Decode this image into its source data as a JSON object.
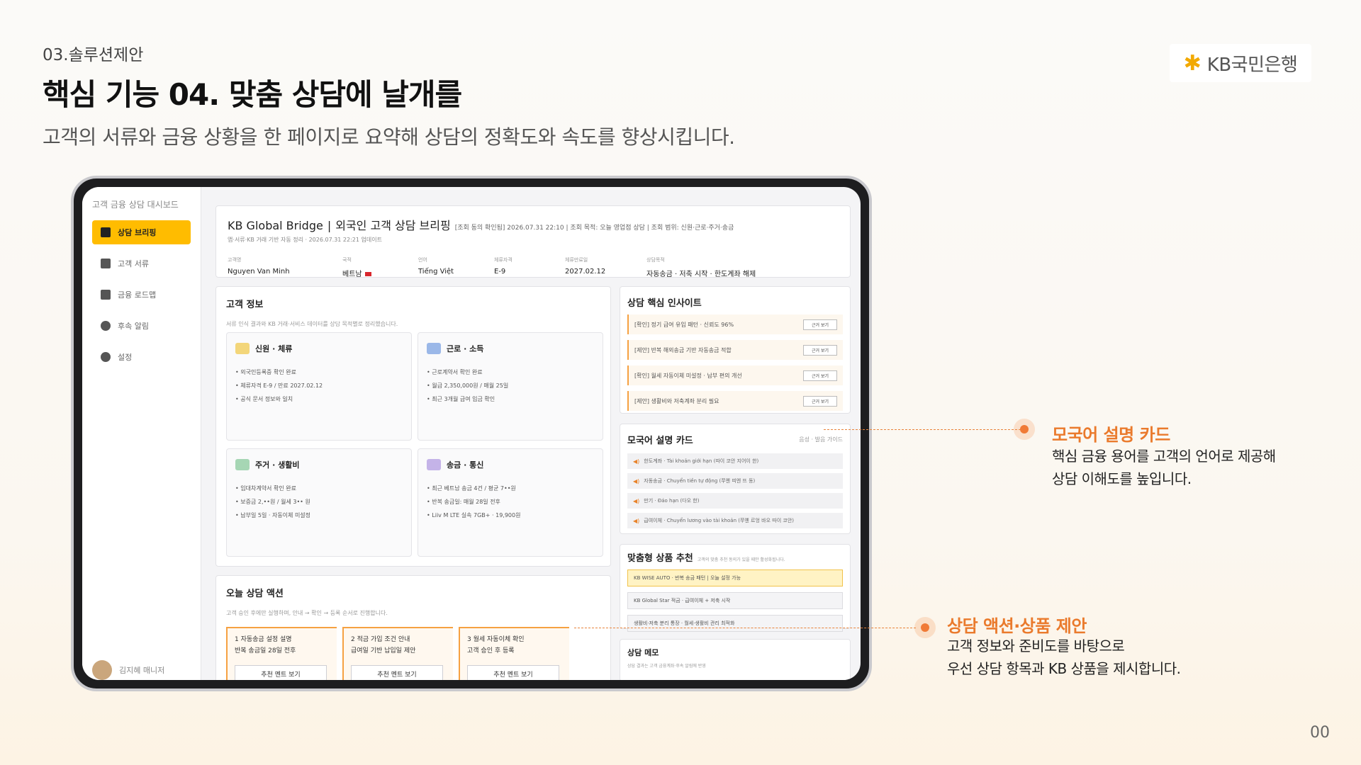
{
  "slide": {
    "section": "03.솔루션제안",
    "title": "핵심 기능 04. 맞춤 상담에 날개를",
    "subtitle": "고객의 서류와 금융 상황을 한 페이지로 요약해 상담의 정확도와 속도를 향상시킵니다.",
    "logo_text": "KB국민은행",
    "page_number": "00"
  },
  "sidebar": {
    "title": "고객 금융 상담 대시보드",
    "items": [
      {
        "label": "상담 브리핑",
        "icon": "briefing-icon",
        "active": true
      },
      {
        "label": "고객 서류",
        "icon": "document-scan-icon",
        "active": false
      },
      {
        "label": "금융 로드맵",
        "icon": "map-icon",
        "active": false
      },
      {
        "label": "후속 알림",
        "icon": "bell-icon",
        "active": false
      },
      {
        "label": "설정",
        "icon": "gear-icon",
        "active": false
      }
    ],
    "user": "김지혜 매니저"
  },
  "header": {
    "brand": "KB Global Bridge",
    "separator": "|",
    "title": "외국인 고객 상담 브리핑",
    "meta": "[조회 동의 확인됨] 2026.07.31 22:10 | 조회 목적: 오늘 영업점 상담 | 조회 범위: 신원·근로·주거·송금",
    "sub": "앱·서류·KB 거래 기반 자동 정리 · 2026.07.31 22:21 업데이트",
    "fields": [
      {
        "label": "고객명",
        "value": "Nguyen Van Minh"
      },
      {
        "label": "국적",
        "value": "베트남"
      },
      {
        "label": "언어",
        "value": "Tiếng Việt"
      },
      {
        "label": "체류자격",
        "value": "E-9"
      },
      {
        "label": "체류만료일",
        "value": "2027.02.12"
      },
      {
        "label": "상담목적",
        "value": "자동송금 · 저축 시작 · 한도계좌 해제"
      }
    ]
  },
  "customer_info": {
    "title": "고객 정보",
    "desc": "서류 인식 결과와 KB 거래·서비스 데이터를 상담 목적별로 정리했습니다.",
    "cards": [
      {
        "title": "신원 · 체류",
        "icon": "person-list-icon",
        "items": [
          "• 외국인등록증 확인 완료",
          "• 체류자격 E-9 / 만료 2027.02.12",
          "• 공식 문서 정보와 일치"
        ]
      },
      {
        "title": "근로 · 소득",
        "icon": "document-icon",
        "items": [
          "• 근로계약서 확인 완료",
          "• 월급 2,350,000원 / 매월 25일",
          "• 최근 3개월 급여 입금 확인"
        ]
      },
      {
        "title": "주거 · 생활비",
        "icon": "home-icon",
        "items": [
          "• 임대차계약서 확인 완료",
          "• 보증금 2,••원 / 월세 3•• 원",
          "• 납부일 5일 · 자동이체 미설정"
        ]
      },
      {
        "title": "송금 · 통신",
        "icon": "transfer-icon",
        "items": [
          "• 최근 베트남 송금 4건 / 평균 7••원",
          "• 반복 송금일: 매월 28일 전후",
          "• Liiv M LTE 실속 7GB+ · 19,900원"
        ]
      }
    ]
  },
  "today_actions": {
    "title": "오늘 상담 액션",
    "desc": "고객 승인 후에만 실행하며, 안내 → 확인 → 등록 순서로 진행합니다.",
    "steps": [
      {
        "title": "1 자동송금 설정 설명",
        "detail": "반복 송금일 28일 전후",
        "button": "추천 멘트 보기"
      },
      {
        "title": "2 적금 가입 조건 안내",
        "detail": "급여일 기반 납입일 제안",
        "button": "추천 멘트 보기"
      },
      {
        "title": "3 월세 자동이체 확인",
        "detail": "고객 승인 후 등록",
        "button": "추천 멘트 보기"
      }
    ]
  },
  "insights": {
    "title": "상담 핵심 인사이트",
    "rows": [
      {
        "text": "[확인] 정기 급여 유입 패턴 · 신뢰도 96%",
        "button": "근거 보기"
      },
      {
        "text": "[제안] 반복 해외송금 기반 자동송금 적합",
        "button": "근거 보기"
      },
      {
        "text": "[확인] 월세 자동이체 미설정 · 납부 편의 개선",
        "button": "근거 보기"
      },
      {
        "text": "[제안] 생활비와 저축계좌 분리 필요",
        "button": "근거 보기"
      }
    ]
  },
  "native_language": {
    "title": "모국어 설명 카드",
    "hint": "음성 · 발음 가이드",
    "rows": [
      "한도계좌 · Tài khoản giới hạn (따이 코안 지어이 한)",
      "자동송금 · Chuyển tiền tự động (쭈옌 띠엔 뜨 동)",
      "만기 · Đáo hạn (다오 한)",
      "급여이체 · Chuyển lương vào tài khoản (쭈옌 르엉 바오 따이 코안)"
    ]
  },
  "recommendations": {
    "title": "맞춤형 상품 추천",
    "desc": "고객의 맞춤 추천 동의가 있을 때만 활성화됩니다.",
    "rows": [
      {
        "text": "KB WISE AUTO · 반복 송금 패턴 | 오늘 설정 가능",
        "highlight": true
      },
      {
        "text": "KB Global Star 적금 · 급여이체 + 저축 시작",
        "highlight": false
      },
      {
        "text": "생활비·저축 분리 통장 · 월세·생활비 관리 최적화",
        "highlight": false
      }
    ]
  },
  "memo": {
    "title": "상담 메모",
    "desc": "상담 결과는 고객 금융계좌·후속 알림에 반영"
  },
  "callouts": [
    {
      "title": "모국어 설명 카드",
      "desc": [
        "핵심 금융 용어를 고객의 언어로 제공해",
        "상담 이해도를 높입니다."
      ]
    },
    {
      "title": "상담 액션·상품 제안",
      "desc": [
        "고객 정보와 준비도를 바탕으로",
        "우선 상담 항목과 KB 상품을 제시합니다."
      ]
    }
  ],
  "colors": {
    "accent": "#ffbc00",
    "callout": "#ea7a2c",
    "highlight_bg": "#fff3c4"
  }
}
